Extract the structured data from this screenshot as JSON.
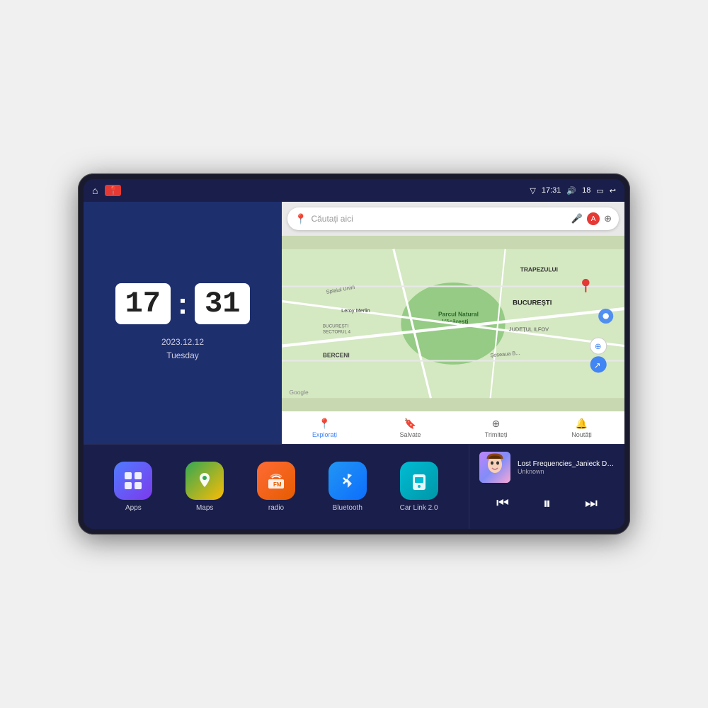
{
  "device": {
    "status_bar": {
      "signal_icon": "▽",
      "time": "17:31",
      "volume_icon": "🔊",
      "battery_level": "18",
      "battery_icon": "▭",
      "back_icon": "↩"
    },
    "nav_icons": {
      "home": "⌂",
      "maps_pin": "📍"
    },
    "clock": {
      "hours": "17",
      "minutes": "31",
      "date": "2023.12.12",
      "day": "Tuesday"
    },
    "map": {
      "search_placeholder": "Căutați aici",
      "nav_items": [
        {
          "label": "Explorați",
          "icon": "📍"
        },
        {
          "label": "Salvate",
          "icon": "🔖"
        },
        {
          "label": "Trimiteți",
          "icon": "⊕"
        },
        {
          "label": "Noutăți",
          "icon": "🔔"
        }
      ],
      "labels": [
        "TRAPEZULUI",
        "BUCUREȘTI",
        "JUDEȚUL ILFOV",
        "BERCENI",
        "Parcul Natural Văcărești",
        "Leroy Merlin",
        "BUCUREȘTI SECTORUL 4"
      ]
    },
    "apps": [
      {
        "id": "apps",
        "label": "Apps",
        "icon": "⊞",
        "bg": "apps-bg"
      },
      {
        "id": "maps",
        "label": "Maps",
        "icon": "📍",
        "bg": "maps-bg"
      },
      {
        "id": "radio",
        "label": "radio",
        "icon": "📻",
        "bg": "radio-bg"
      },
      {
        "id": "bluetooth",
        "label": "Bluetooth",
        "icon": "⌖",
        "bg": "bt-bg"
      },
      {
        "id": "carlink",
        "label": "Car Link 2.0",
        "icon": "📱",
        "bg": "carlink-bg"
      }
    ],
    "music": {
      "title": "Lost Frequencies_Janieck Devy-...",
      "artist": "Unknown",
      "prev": "⏮",
      "play": "⏸",
      "next": "⏭"
    }
  }
}
